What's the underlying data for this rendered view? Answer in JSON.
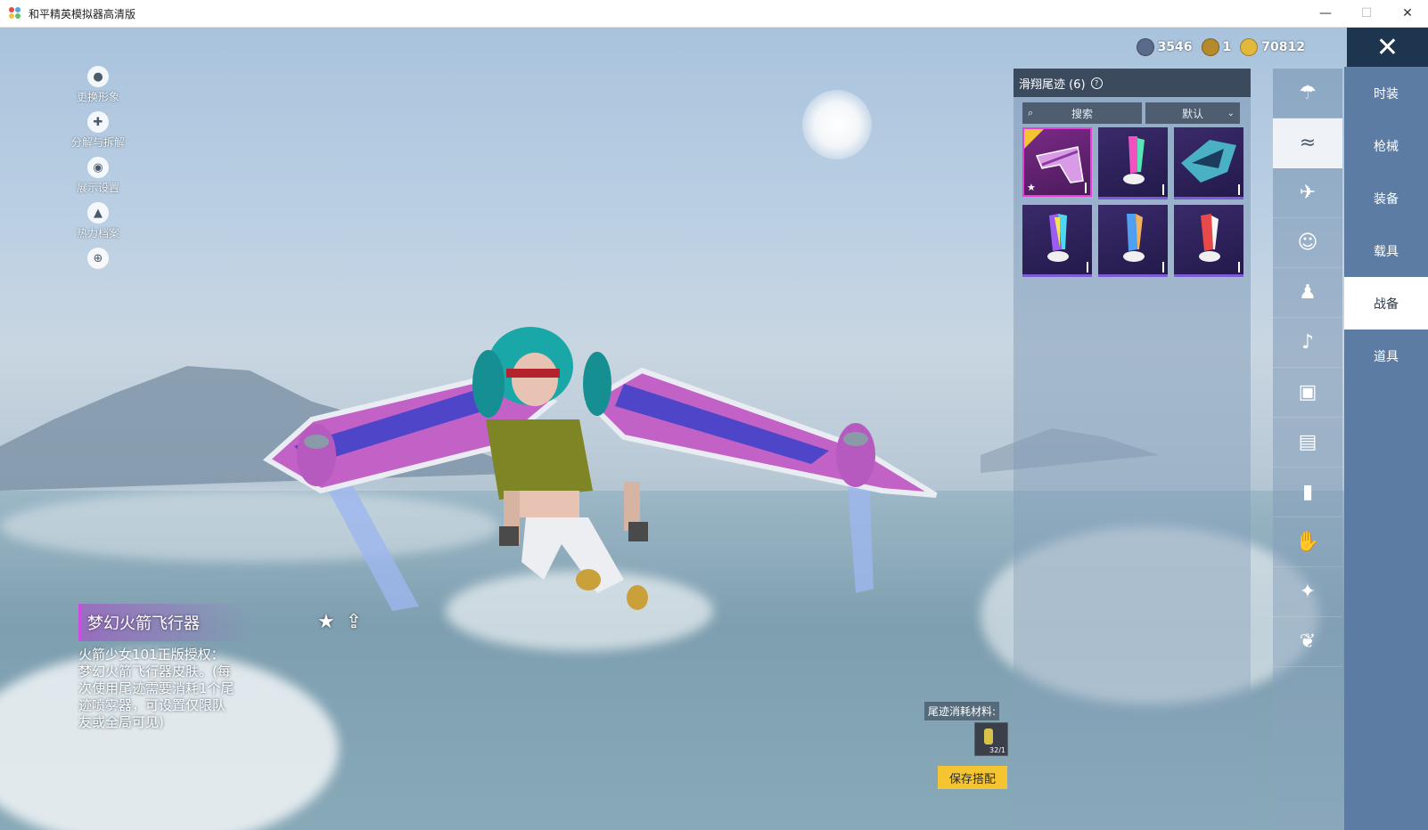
{
  "window": {
    "title": "和平精英模拟器高清版",
    "minimize": "—",
    "maximize": "☐",
    "close": "✕"
  },
  "left_tools": [
    {
      "label": "更换形象",
      "icon": "person-icon",
      "glyph": "●"
    },
    {
      "label": "分解与拆解",
      "icon": "puzzle-icon",
      "glyph": "✚"
    },
    {
      "label": "展示设置",
      "icon": "eye-icon",
      "glyph": "◉"
    },
    {
      "label": "热力档案",
      "icon": "flame-icon",
      "glyph": "▲"
    },
    {
      "label": "",
      "icon": "zoom-in-icon",
      "glyph": "⊕"
    }
  ],
  "currency": [
    {
      "value": "3546",
      "color": "#5a6a8a",
      "icon": "silver-coin-icon"
    },
    {
      "value": "1",
      "color": "#b58a2a",
      "icon": "bronze-token-icon"
    },
    {
      "value": "70812",
      "color": "#e2b93b",
      "icon": "gold-coin-icon"
    }
  ],
  "close_button": "✕",
  "panel": {
    "title": "滑翔尾迹 (6)",
    "help": "?",
    "search_placeholder": "搜索",
    "sort_label": "默认",
    "items": [
      {
        "name": "pink-wing-trail",
        "selected": true,
        "favorited": true,
        "equipped": true,
        "colors": [
          "#c55de0",
          "#ffffff"
        ]
      },
      {
        "name": "rainbow-trail-1",
        "selected": false,
        "colors": [
          "#f052c0",
          "#59e6b7"
        ]
      },
      {
        "name": "mecha-wing-trail",
        "selected": false,
        "colors": [
          "#4ab1c4",
          "#1d3b5b"
        ]
      },
      {
        "name": "rainbow-trail-2",
        "selected": false,
        "colors": [
          "#9c5cf0",
          "#4fd6f3"
        ]
      },
      {
        "name": "blue-flame-trail",
        "selected": false,
        "colors": [
          "#4f9ff3",
          "#f2b35c"
        ]
      },
      {
        "name": "red-flame-trail",
        "selected": false,
        "colors": [
          "#e84a4a",
          "#f5f5f5"
        ]
      }
    ]
  },
  "category_icons": [
    {
      "icon": "parachute-icon",
      "glyph": "☂",
      "active": false
    },
    {
      "icon": "glide-trail-icon",
      "glyph": "≈",
      "active": true
    },
    {
      "icon": "plane-icon",
      "glyph": "✈",
      "active": false
    },
    {
      "icon": "emote-face-icon",
      "glyph": "☺",
      "active": false
    },
    {
      "icon": "robot-icon",
      "glyph": "♟",
      "active": false
    },
    {
      "icon": "speaker-icon",
      "glyph": "♪",
      "active": false
    },
    {
      "icon": "box-icon",
      "glyph": "▣",
      "active": false
    },
    {
      "icon": "gallery-icon",
      "glyph": "▤",
      "active": false
    },
    {
      "icon": "spray-can-icon",
      "glyph": "▮",
      "active": false
    },
    {
      "icon": "hand-icon",
      "glyph": "✋",
      "active": false
    },
    {
      "icon": "sparkle-wand-icon",
      "glyph": "✦",
      "active": false
    },
    {
      "icon": "bird-icon",
      "glyph": "❦",
      "active": false
    }
  ],
  "nav": [
    {
      "label": "时装",
      "active": false
    },
    {
      "label": "枪械",
      "active": false
    },
    {
      "label": "装备",
      "active": false
    },
    {
      "label": "载具",
      "active": false
    },
    {
      "label": "战备",
      "active": true
    },
    {
      "label": "道具",
      "active": false
    }
  ],
  "item_detail": {
    "name": "梦幻火箭飞行器",
    "description": "火箭少女101正版授权：梦幻火箭飞行器皮肤。(每次使用尾迹需要消耗1个尾迹喷雾器，可设置仅限队友或全局可见)",
    "favorite_glyph": "★",
    "share_glyph": "⇪"
  },
  "material": {
    "label": "尾迹消耗材料:",
    "count": "32/1"
  },
  "save_button": "保存搭配"
}
